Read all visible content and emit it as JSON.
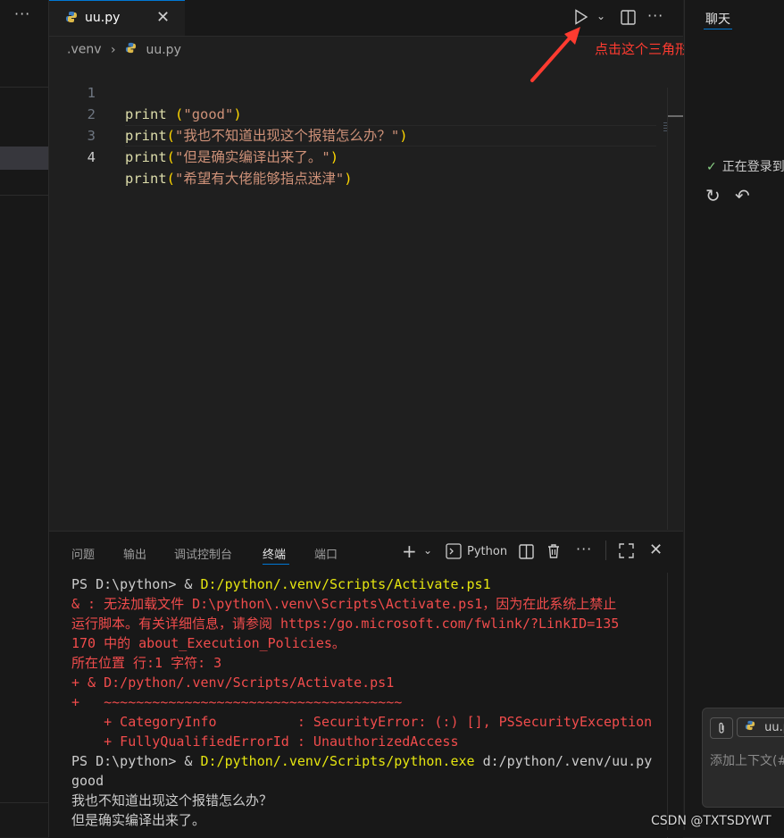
{
  "sidebar": {
    "more_label": "···"
  },
  "tab": {
    "filename": "uu.py",
    "close": "✕"
  },
  "toolbar": {
    "run_dropdown": "⌄",
    "more": "···"
  },
  "breadcrumb": {
    "folder": ".venv",
    "separator": "›",
    "file": "uu.py"
  },
  "editor": {
    "lines": [
      {
        "num": "1",
        "fn": "print",
        "space": " ",
        "open": "(",
        "str": "\"good\"",
        "close": ")"
      },
      {
        "num": "2",
        "fn": "print",
        "space": "",
        "open": "(",
        "str": "\"我也不知道出现这个报错怎么办？\"",
        "close": ")"
      },
      {
        "num": "3",
        "fn": "print",
        "space": "",
        "open": "(",
        "str": "\"但是确实编译出来了。\"",
        "close": ")"
      },
      {
        "num": "4",
        "fn": "print",
        "space": "",
        "open": "(",
        "str": "\"希望有大佬能够指点迷津\"",
        "close": ")"
      }
    ]
  },
  "annotation": {
    "text": "点击这个三角形，运行",
    "color": "#ff3b30"
  },
  "panel": {
    "tabs": [
      "问题",
      "输出",
      "调试控制台",
      "终端",
      "端口"
    ],
    "active_tab": "终端",
    "shell": "Python",
    "terminal": {
      "l1_prefix": "PS D:\\python> & ",
      "l1_path": "D:/python/.venv/Scripts/Activate.ps1",
      "e1": "& : 无法加载文件 D:\\python\\.venv\\Scripts\\Activate.ps1，因为在此系统上禁止",
      "e2": "运行脚本。有关详细信息，请参阅 https:/go.microsoft.com/fwlink/?LinkID=135",
      "e3": "170 中的 about_Execution_Policies。",
      "e4": "所在位置 行:1 字符: 3",
      "e5": "+ & D:/python/.venv/Scripts/Activate.ps1",
      "e6": "+   ~~~~~~~~~~~~~~~~~~~~~~~~~~~~~~~~~~~~~",
      "e7": "    + CategoryInfo          : SecurityError: (:) [], PSSecurityException",
      "e8": "    + FullyQualifiedErrorId : UnauthorizedAccess",
      "l2_prefix": "PS D:\\python> & ",
      "l2_path": "D:/python/.venv/Scripts/python.exe",
      "l2_suffix": " d:/python/.venv/uu.py",
      "o1": "good",
      "o2": "我也不知道出现这个报错怎么办？",
      "o3": "但是确实编译出来了。"
    }
  },
  "chat": {
    "tab": "聊天",
    "status": "正在登录到",
    "file_chip": "uu.py",
    "placeholder": "添加上下文(#)"
  },
  "watermark": "CSDN @TXTSDYWT",
  "colors": {
    "accent": "#0078d4",
    "error": "#f14c4c",
    "path": "#e5e510"
  }
}
